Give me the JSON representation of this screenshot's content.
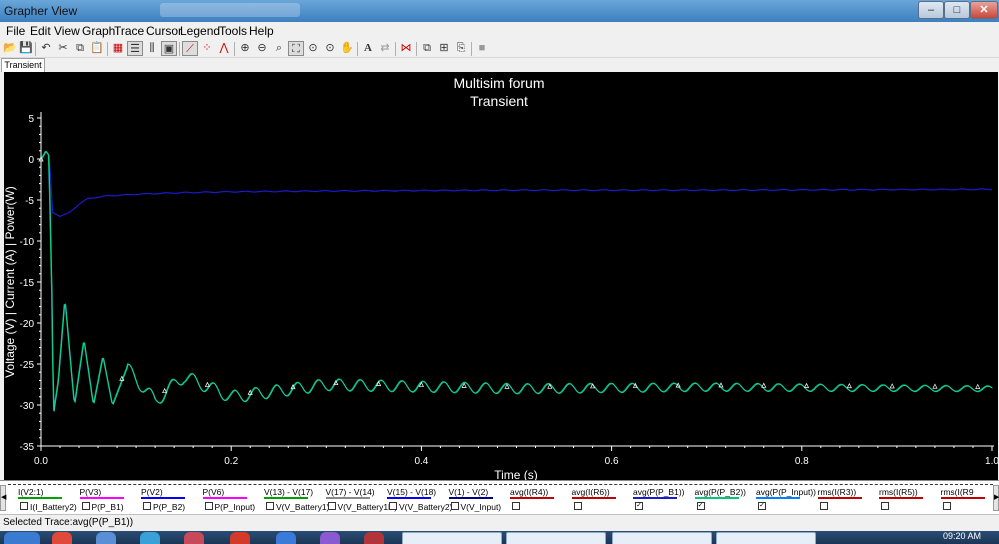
{
  "window": {
    "title": "Grapher View",
    "min_glyph": "–",
    "max_glyph": "□",
    "close_glyph": "✕"
  },
  "menu": [
    "File",
    "Edit",
    "View",
    "Graph",
    "Trace",
    "Cursor",
    "Legend",
    "Tools",
    "Help"
  ],
  "toolbar": {
    "icons": [
      "open-icon",
      "save-icon",
      "undo-icon",
      "cut-icon",
      "copy-icon",
      "paste-icon",
      "grid-icon",
      "legend-icon",
      "cursors-icon",
      "properties-icon",
      "select-trace-icon",
      "data-points-icon",
      "show-markers-icon",
      "zoom-in-icon",
      "zoom-out-icon",
      "zoom-area-icon",
      "zoom-full-icon",
      "zoom-y-icon",
      "pan-icon",
      "text-icon",
      "reverse-colors-icon",
      "export-icon",
      "overlay-icon",
      "add-traces-icon",
      "copy-graph-icon",
      "print-icon"
    ],
    "text_label": "A"
  },
  "tabs": [
    "Transient"
  ],
  "chart_data": {
    "type": "line",
    "title": "Multisim forum",
    "subtitle": "Transient",
    "xlabel": "Time (s)",
    "ylabel": "Voltage (V) | Current (A) | Power(W)",
    "xlim": [
      0,
      1.0
    ],
    "ylim": [
      -35,
      5
    ],
    "xticks": [
      "0.0",
      "0.2",
      "0.4",
      "0.6",
      "0.8",
      "1.0"
    ],
    "yticks": [
      "5",
      "0",
      "-5",
      "-10",
      "-15",
      "-20",
      "-25",
      "-30",
      "-35"
    ],
    "grid": false,
    "background": "#000000",
    "series": [
      {
        "name": "avg(P(P_B1))",
        "color": "#1a1ad0",
        "x": [
          0.0,
          0.005,
          0.008,
          0.01,
          0.012,
          0.02,
          0.03,
          0.04,
          0.05,
          0.07,
          0.1,
          0.15,
          0.2,
          0.3,
          0.5,
          0.7,
          1.0
        ],
        "y": [
          0.0,
          1.0,
          0.5,
          -2.0,
          -6.5,
          -7.0,
          -6.5,
          -5.5,
          -4.8,
          -4.5,
          -4.3,
          -4.1,
          -4.0,
          -3.9,
          -3.8,
          -3.8,
          -3.7
        ]
      },
      {
        "name": "avg(P(P_B2))",
        "color": "#00c878",
        "x": [
          0.0,
          0.005,
          0.008,
          0.011,
          0.013,
          0.018,
          0.025,
          0.035,
          0.045,
          0.055,
          0.065,
          0.075,
          0.09,
          0.12,
          0.15,
          0.2,
          0.3,
          0.5,
          0.7,
          1.0
        ],
        "y": [
          0.0,
          1.0,
          0.5,
          -15.0,
          -31.0,
          -27.0,
          -17.0,
          -30.0,
          -22.0,
          -30.0,
          -24.0,
          -30.0,
          -25.5,
          -29.5,
          -26.5,
          -29.0,
          -27.5,
          -28.0,
          -27.8,
          -28.0
        ]
      }
    ]
  },
  "legend": {
    "row1": [
      {
        "label": "I(V2:1)",
        "color": "#00a000"
      },
      {
        "label": "P(V3)",
        "color": "#ff00ff"
      },
      {
        "label": "P(V2)",
        "color": "#0000ff"
      },
      {
        "label": "P(V6)",
        "color": "#ff00ff"
      },
      {
        "label": "V(13) - V(17)",
        "color": "#00a000"
      },
      {
        "label": "V(17) - V(14)",
        "color": "#888888"
      },
      {
        "label": "V(15) - V(18)",
        "color": "#0000ff"
      },
      {
        "label": "V(1) - V(2)",
        "color": "#000080"
      },
      {
        "label": "avg(I(R4))",
        "color": "#c00000"
      },
      {
        "label": "avg(I(R6))",
        "color": "#c00000"
      },
      {
        "label": "avg(P(P_B1))",
        "color": "#1a1ad0"
      },
      {
        "label": "avg(P(P_B2))",
        "color": "#00c878"
      },
      {
        "label": "avg(P(P_Input))",
        "color": "#0080ff"
      },
      {
        "label": "rms(I(R3))",
        "color": "#c00000"
      },
      {
        "label": "rms(I(R5))",
        "color": "#c00000"
      },
      {
        "label": "rms(I(R9",
        "color": "#c00000"
      }
    ],
    "row2": [
      {
        "label": "I(I_Battery2)",
        "checked": false
      },
      {
        "label": "P(P_B1)",
        "checked": false
      },
      {
        "label": "P(P_B2)",
        "checked": false
      },
      {
        "label": "P(P_Input)",
        "checked": false
      },
      {
        "label": "V(V_Battery1)",
        "checked": false
      },
      {
        "label": "V(V_Battery1R)",
        "checked": false
      },
      {
        "label": "V(V_Battery2)",
        "checked": false
      },
      {
        "label": "V(V_Input)",
        "checked": false
      },
      {
        "label": "",
        "checked": false
      },
      {
        "label": "",
        "checked": false
      },
      {
        "label": "",
        "checked": true
      },
      {
        "label": "",
        "checked": true
      },
      {
        "label": "",
        "checked": true
      },
      {
        "label": "",
        "checked": false
      },
      {
        "label": "",
        "checked": false
      },
      {
        "label": "",
        "checked": false
      }
    ]
  },
  "status": "Selected Trace:avg(P(P_B1))",
  "taskbar": {
    "clock": "09:20 AM"
  }
}
